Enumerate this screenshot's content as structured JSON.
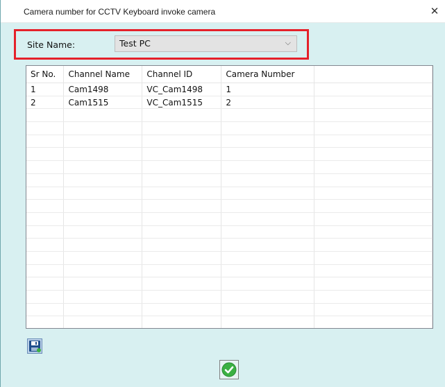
{
  "window": {
    "title": "Camera number for CCTV Keyboard invoke camera",
    "close_glyph": "✕"
  },
  "site": {
    "label": "Site Name:",
    "selected": "Test PC",
    "chevron": "⌵"
  },
  "grid": {
    "columns": [
      "Sr No.",
      "Channel Name",
      "Channel ID",
      "Camera Number",
      ""
    ],
    "rows": [
      [
        "1",
        "Cam1498",
        "VC_Cam1498",
        "1",
        ""
      ],
      [
        "2",
        "Cam1515",
        "VC_Cam1515",
        "2",
        ""
      ]
    ]
  },
  "toolbar": {
    "save_icon": "floppy-save-icon",
    "ok_icon": "green-check-icon"
  },
  "colors": {
    "window_bg": "#d8f0f1",
    "highlight_border": "#e5212a",
    "ok_green": "#3cb043"
  }
}
